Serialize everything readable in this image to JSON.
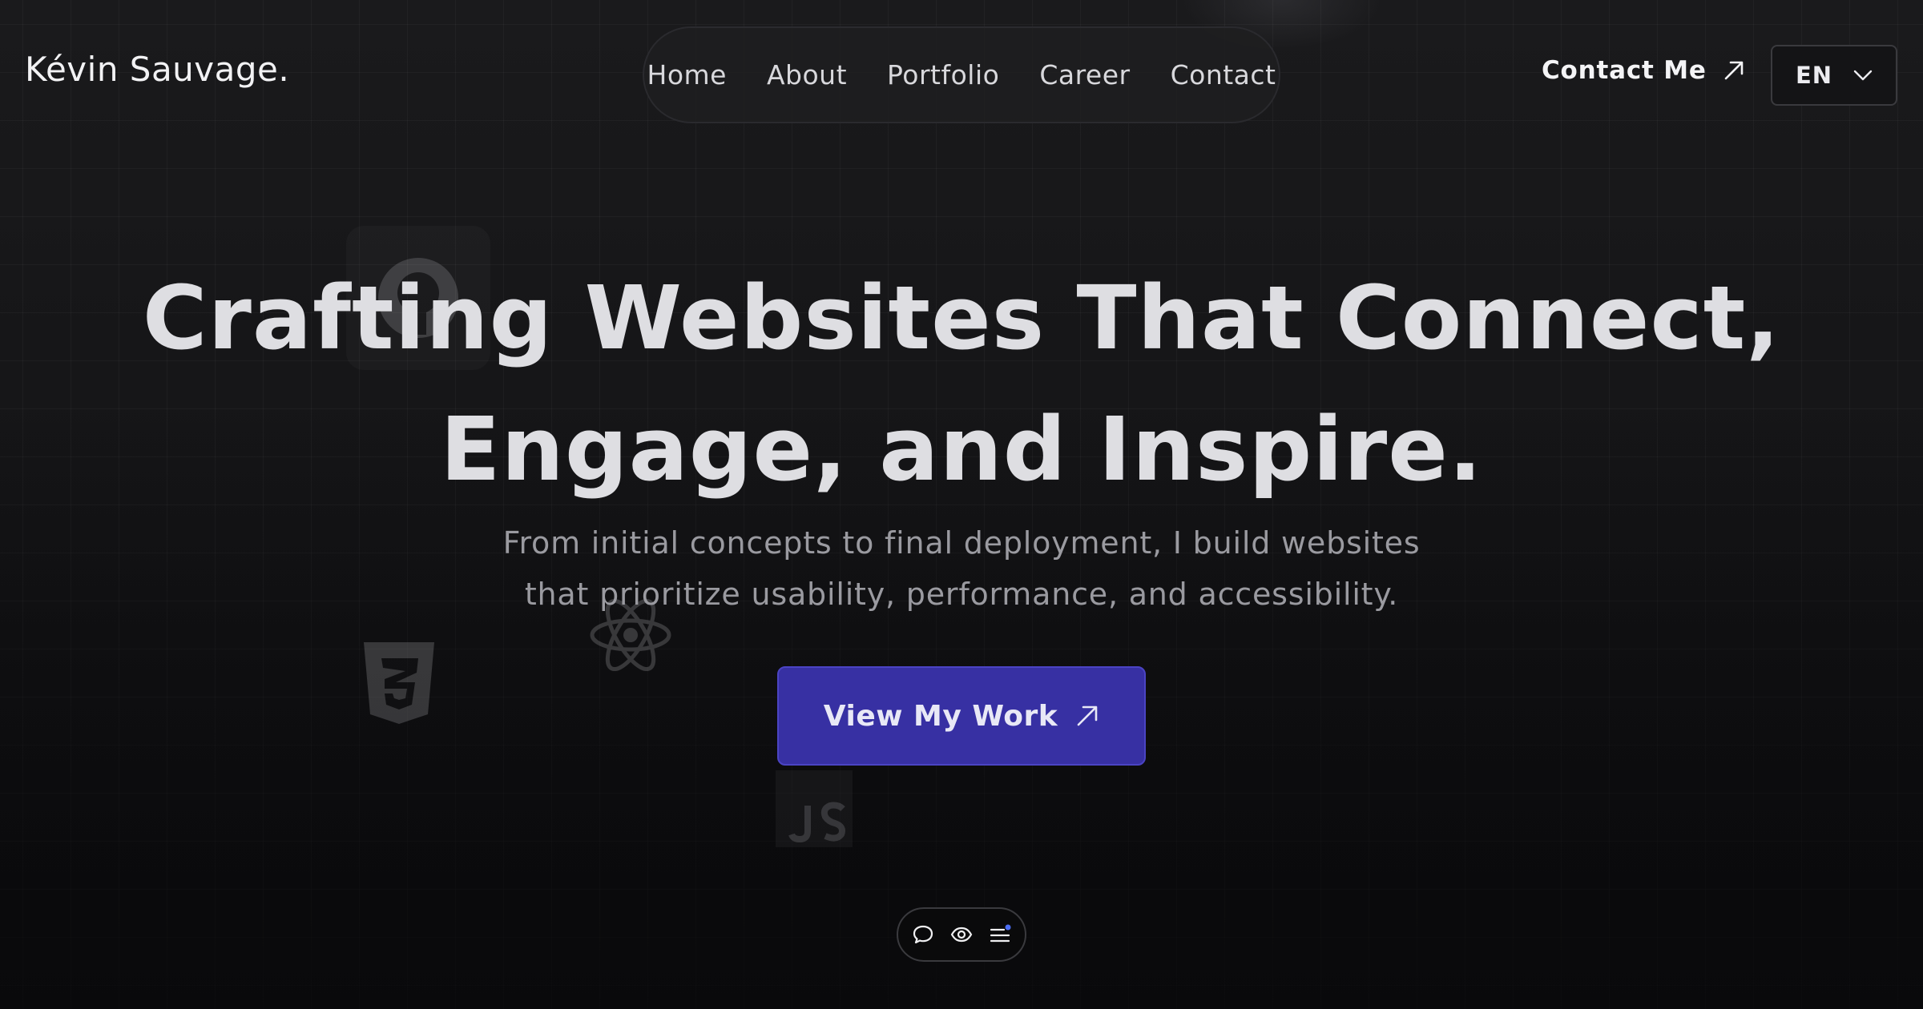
{
  "header": {
    "logo": "Kévin Sauvage.",
    "nav": [
      "Home",
      "About",
      "Portfolio",
      "Career",
      "Contact"
    ],
    "contact_cta": "Contact Me",
    "language": "EN"
  },
  "hero": {
    "title_line1": "Crafting Websites That Connect,",
    "title_line2": "Engage, and Inspire.",
    "subtitle_line1": "From initial concepts to final deployment, I build websites",
    "subtitle_line2": "that prioritize usability, performance, and accessibility.",
    "cta": "View My Work"
  },
  "decor_icons": [
    "github-icon",
    "css3-icon",
    "react-icon",
    "javascript-icon"
  ],
  "toolbar": [
    "chat-icon",
    "eye-icon",
    "menu-icon"
  ],
  "colors": {
    "background": "#0f0f11",
    "cta": "#3730a3",
    "text": "#dedee2",
    "accent_dot": "#4c6ef5"
  }
}
